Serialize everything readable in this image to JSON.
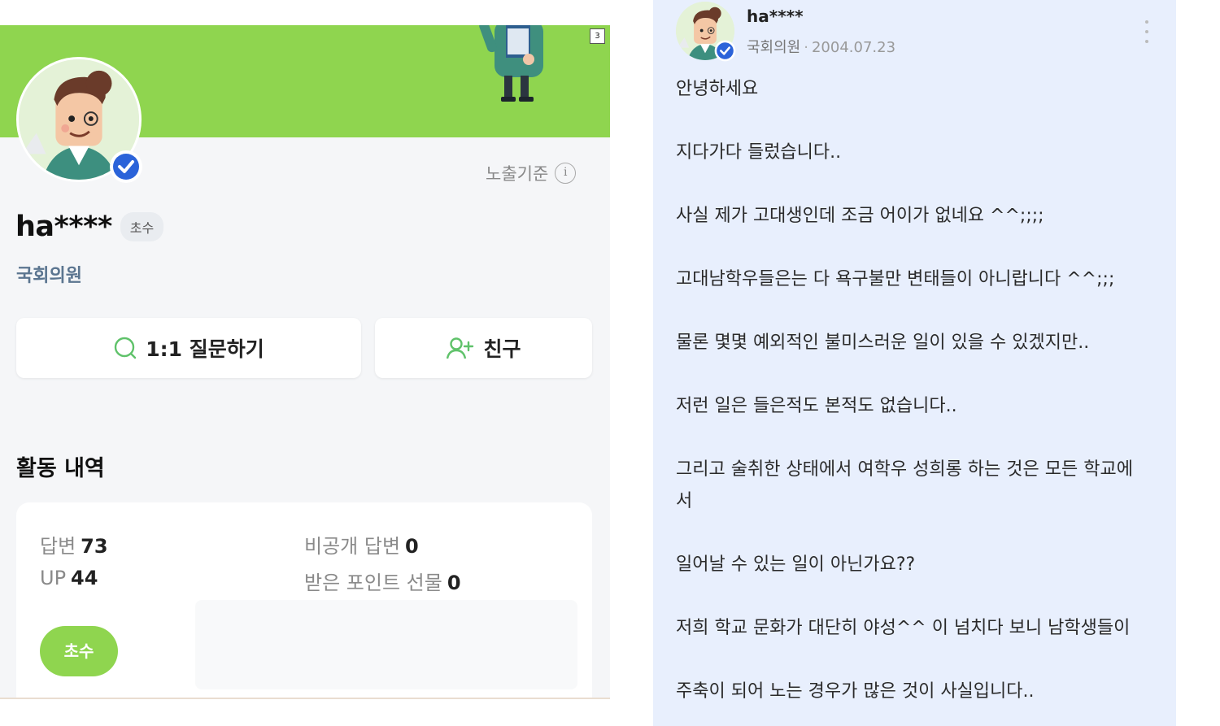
{
  "profile": {
    "banner_badge": "3",
    "expose_label": "노출기준",
    "info_icon_glyph": "i",
    "name": "ha****",
    "grade_chip": "초수",
    "title": "국회의원",
    "question_button": "1:1 질문하기",
    "friend_button": "친구",
    "activity_title": "활동 내역",
    "stats": {
      "answers_label": "답변",
      "answers_value": "73",
      "up_label": "UP",
      "up_value": "44",
      "private_label": "비공개 답변",
      "private_value": "0",
      "gift_label": "받은 포인트 선물",
      "gift_value": "0"
    },
    "grade_badge": "초수",
    "colors": {
      "banner": "#8fd54f",
      "verified": "#2b63d9",
      "title": "#5b7590"
    }
  },
  "post": {
    "author": "ha****",
    "author_title": "국회의원",
    "separator": "·",
    "date": "2004.07.23",
    "lines": [
      "안녕하세요",
      "지다가다 들렀습니다..",
      "사실 제가 고대생인데 조금 어이가 없네요 ^^;;;;",
      "고대남학우들은는 다 욕구불만 변태들이 아니랍니다 ^^;;;",
      "물론 몇몇 예외적인 불미스러운 일이 있을 수 있겠지만..",
      "저런 일은 들은적도 본적도 없습니다..",
      "그리고 술취한 상태에서 여학우 성희롱 하는 것은 모든 학교에",
      "서",
      "일어날 수 있는 일이 아닌가요??",
      "저희 학교 문화가 대단히 야성^^ 이 넘치다 보니 남학생들이",
      "주축이 되어 노는 경우가 많은 것이 사실입니다.."
    ],
    "colors": {
      "background": "#e8effd"
    }
  }
}
